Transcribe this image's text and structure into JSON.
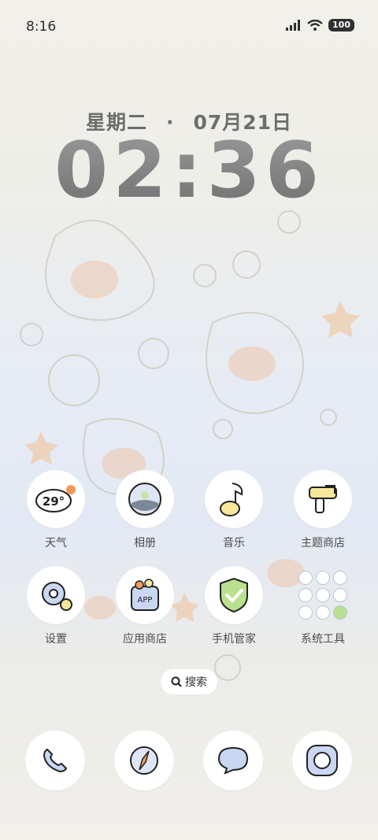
{
  "status_bar": {
    "time": "8:16",
    "battery": "100"
  },
  "lockscreen": {
    "date_weekday": "星期二",
    "date_separator": "·",
    "date_day": "07月21日",
    "clock": "02:36"
  },
  "weather_widget_temp": "29°",
  "apps_row1": [
    {
      "label": "天气",
      "icon": "weather-icon"
    },
    {
      "label": "相册",
      "icon": "gallery-icon"
    },
    {
      "label": "音乐",
      "icon": "music-icon"
    },
    {
      "label": "主题商店",
      "icon": "theme-store-icon"
    }
  ],
  "apps_row2": [
    {
      "label": "设置",
      "icon": "settings-icon"
    },
    {
      "label": "应用商店",
      "icon": "app-store-icon",
      "badge": "APP"
    },
    {
      "label": "手机管家",
      "icon": "phone-manager-icon"
    },
    {
      "label": "系统工具",
      "icon": "folder-system-tools"
    }
  ],
  "search": {
    "label": "搜索"
  },
  "dock": [
    {
      "icon": "phone-icon"
    },
    {
      "icon": "browser-icon"
    },
    {
      "icon": "messages-icon"
    },
    {
      "icon": "camera-icon"
    }
  ]
}
